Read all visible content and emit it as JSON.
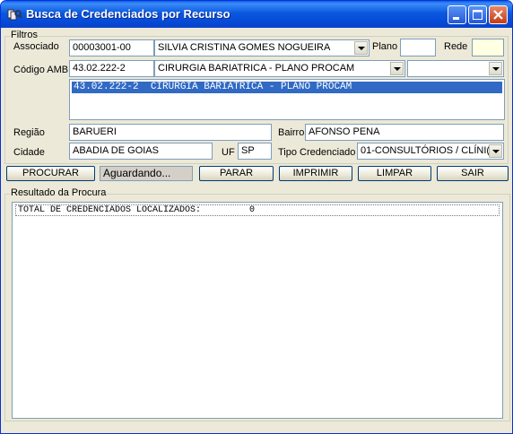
{
  "window": {
    "title": "Busca de Credenciados por Recurso"
  },
  "filtros": {
    "group_label": "Filtros",
    "associado_label": "Associado",
    "associado_code": "00003001-00",
    "associado_name": "SILVIA CRISTINA GOMES NOGUEIRA",
    "plano_label": "Plano",
    "plano_value": "",
    "rede_label": "Rede",
    "rede_value": "",
    "codigo_amb_label": "Código AMB",
    "codigo_amb_code": "43.02.222-2",
    "codigo_amb_desc": "CIRURGIA BARIATRICA - PLANO PROCAM",
    "codigo_amb_extra": "",
    "codigo_list": [
      "43.02.222-2  CIRURGIA BARIATRICA - PLANO PROCAM"
    ],
    "regiao_label": "Região",
    "regiao_value": "BARUERI",
    "bairro_label": "Bairro",
    "bairro_value": "AFONSO PENA",
    "cidade_label": "Cidade",
    "cidade_value": "ABADIA DE GOIAS",
    "uf_label": "UF",
    "uf_value": "SP",
    "tipo_label": "Tipo Credenciado",
    "tipo_value": "01-CONSULTÓRIOS / CLÍNI("
  },
  "actions": {
    "procurar": "PROCURAR",
    "status": "Aguardando...",
    "parar": "PARAR",
    "imprimir": "IMPRIMIR",
    "limpar": "LIMPAR",
    "sair": "SAIR"
  },
  "resultado": {
    "group_label": "Resultado da Procura",
    "total_line": "TOTAL DE CREDENCIADOS LOCALIZADOS:         0"
  }
}
